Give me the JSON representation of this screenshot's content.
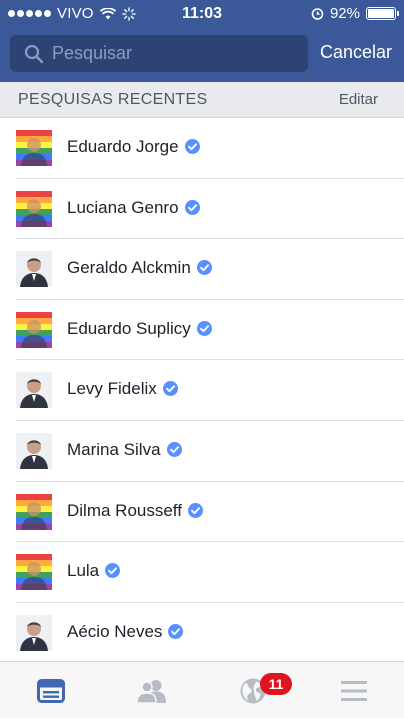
{
  "status_bar": {
    "carrier": "VIVO",
    "time": "11:03",
    "battery_percent_label": "92%",
    "battery_level": 0.92,
    "signal_dots": 5
  },
  "search": {
    "placeholder": "Pesquisar",
    "value": "",
    "cancel_label": "Cancelar"
  },
  "section": {
    "title": "PESQUISAS RECENTES",
    "edit_label": "Editar"
  },
  "recent_searches": [
    {
      "name": "Eduardo Jorge",
      "verified": true,
      "avatar_style": "rainbow"
    },
    {
      "name": "Luciana Genro",
      "verified": true,
      "avatar_style": "rainbow"
    },
    {
      "name": "Geraldo Alckmin",
      "verified": true,
      "avatar_style": "portrait-light"
    },
    {
      "name": "Eduardo Suplicy",
      "verified": true,
      "avatar_style": "rainbow"
    },
    {
      "name": "Levy Fidelix",
      "verified": true,
      "avatar_style": "portrait-light"
    },
    {
      "name": "Marina Silva",
      "verified": true,
      "avatar_style": "portrait-light"
    },
    {
      "name": "Dilma Rousseff",
      "verified": true,
      "avatar_style": "rainbow"
    },
    {
      "name": "Lula",
      "verified": true,
      "avatar_style": "rainbow"
    },
    {
      "name": "Aécio Neves",
      "verified": true,
      "avatar_style": "portrait-light"
    }
  ],
  "tabbar": {
    "tabs": [
      {
        "icon": "news-feed-icon",
        "active": true
      },
      {
        "icon": "friends-icon",
        "active": false
      },
      {
        "icon": "notifications-globe-icon",
        "active": false,
        "badge": "11"
      },
      {
        "icon": "menu-icon",
        "active": false
      }
    ]
  },
  "colors": {
    "header_blue": "#3b5998",
    "search_bg": "#2d4373",
    "verified_blue": "#5890ff",
    "badge_red": "#e0141e",
    "active_tab": "#4267b2"
  }
}
